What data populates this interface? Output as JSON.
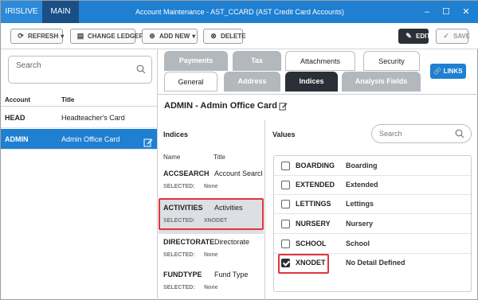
{
  "titlebar": {
    "tab_primary": "IRISLIVE",
    "tab_main": "MAIN",
    "title": "Account Maintenance - AST_CCARD (AST Credit Card Accounts)",
    "controls": [
      "–",
      "☐",
      "✕"
    ]
  },
  "toolbar": {
    "refresh": "REFRESH",
    "change_ledger": "CHANGE LEDGER",
    "add_new": "ADD NEW",
    "delete": "DELETE",
    "edit": "EDIT",
    "save": "SAVE"
  },
  "left_panel": {
    "search_placeholder": "Search",
    "columns": {
      "account": "Account",
      "title": "Title"
    },
    "rows": [
      {
        "account": "HEAD",
        "title": "Headteacher's Card",
        "selected": false
      },
      {
        "account": "ADMIN",
        "title": "Admin Office Card",
        "selected": true
      }
    ]
  },
  "tabs": {
    "row1": [
      "Payments",
      "Tax",
      "Attachments",
      "Security"
    ],
    "row2": [
      "General",
      "Address",
      "Indices",
      "Analysis Fields"
    ],
    "active": "Indices",
    "links": "LINKS"
  },
  "record": {
    "title": "ADMIN - Admin Office Card"
  },
  "indices": {
    "label": "Indices",
    "col_name": "Name",
    "col_title": "Title",
    "selected_label": "SELECTED:",
    "items": [
      {
        "name": "ACCSEARCH",
        "title": "Account Searcl",
        "selected": "None"
      },
      {
        "name": "ACTIVITIES",
        "title": "Activities",
        "selected": "XNODET"
      },
      {
        "name": "DIRECTORATE",
        "title": "Directorate",
        "selected": "None"
      },
      {
        "name": "FUNDTYPE",
        "title": "Fund Type",
        "selected": "None"
      }
    ]
  },
  "values": {
    "label": "Values",
    "search_placeholder": "Search",
    "rows": [
      {
        "code": "BOARDING",
        "desc": "Boarding",
        "checked": false
      },
      {
        "code": "EXTENDED",
        "desc": "Extended",
        "checked": false
      },
      {
        "code": "LETTINGS",
        "desc": "Lettings",
        "checked": false
      },
      {
        "code": "NURSERY",
        "desc": "Nursery",
        "checked": false
      },
      {
        "code": "SCHOOL",
        "desc": "School",
        "checked": false
      },
      {
        "code": "XNODET",
        "desc": "No Detail Defined",
        "checked": true
      }
    ]
  },
  "colors": {
    "accent": "#1f7fd1",
    "dark": "#2b2f36",
    "highlight": "#e0353f"
  }
}
